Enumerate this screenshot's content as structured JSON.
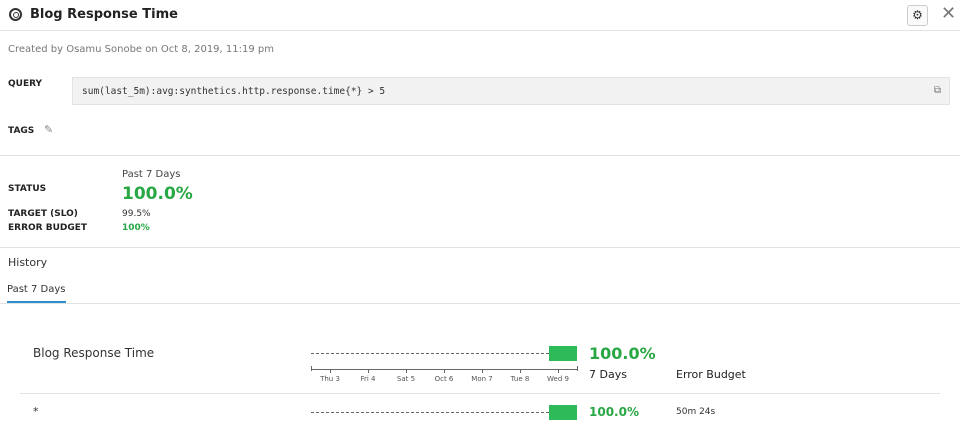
{
  "header": {
    "title": "Blog Response Time",
    "settings_icon": "gear-icon",
    "close_icon": "close-icon"
  },
  "meta": {
    "created": "Created by Osamu Sonobe on Oct 8, 2019, 11:19 pm"
  },
  "query": {
    "label": "QUERY",
    "value": "sum(last_5m):avg:synthetics.http.response.time{*} > 5"
  },
  "tags": {
    "label": "TAGS"
  },
  "status": {
    "period": "Past 7 Days",
    "status_label": "STATUS",
    "status_value": "100.0%",
    "target_label": "TARGET (SLO)",
    "target_value": "99.5%",
    "budget_label": "ERROR BUDGET",
    "budget_value": "100%"
  },
  "history": {
    "title": "History",
    "tabs": [
      {
        "label": "Past 7 Days",
        "active": true
      }
    ]
  },
  "chart_data": {
    "type": "bar",
    "categories": [
      "Thu 3",
      "Fri 4",
      "Sat 5",
      "Oct 6",
      "Mon 7",
      "Tue 8",
      "Wed 9"
    ],
    "rows": [
      {
        "name": "Blog Response Time",
        "value": "100.0%",
        "period_label": "7 Days",
        "budget_header": "Error Budget",
        "uptime_fraction": 1.0
      },
      {
        "name": "*",
        "value": "100.0%",
        "budget": "50m 24s",
        "uptime_fraction": 1.0
      }
    ],
    "color": "#2dbb5a"
  }
}
